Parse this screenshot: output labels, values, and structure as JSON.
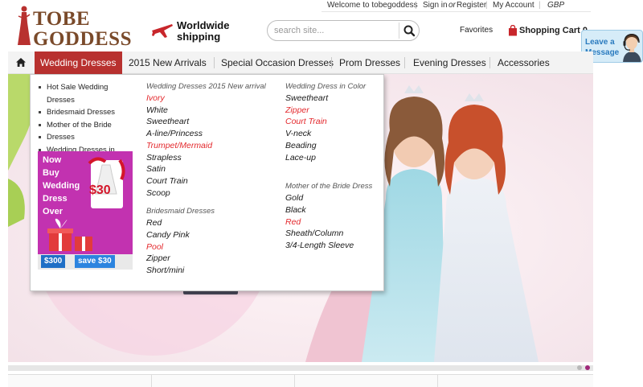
{
  "topbar": {
    "welcome": "Welcome to tobegoddess",
    "sign_in": "Sign in",
    "or": "or",
    "register": "Register",
    "account": "My Account",
    "currency": "GBP"
  },
  "logo": {
    "line1": "TOBE",
    "line2": "GODDESS"
  },
  "shipping": {
    "line1": "Worldwide",
    "line2": "shipping"
  },
  "search": {
    "placeholder": "search site...",
    "icon": "search-icon"
  },
  "header": {
    "favorites": "Favorites",
    "cart_label": "Shopping Cart",
    "cart_count": "0"
  },
  "leave_message": {
    "line1": "Leave a",
    "line2": "Message"
  },
  "nav": {
    "items": [
      {
        "label": "Wedding Dresses"
      },
      {
        "label": "2015 New Arrivals"
      },
      {
        "label": "Special Occasion Dresses"
      },
      {
        "label": "Prom Dresses"
      },
      {
        "label": "Evening Dresses"
      },
      {
        "label": "Accessories"
      }
    ]
  },
  "dropdown": {
    "links": [
      "Hot Sale Wedding Dresses",
      "Bridesmaid Dresses",
      "Mother of the Bride",
      "Dresses",
      "Wedding Dresses in Color"
    ],
    "promo": {
      "lines": [
        "Now",
        "Buy",
        "Wedding",
        "Dress",
        "Over"
      ],
      "price": "$30",
      "bottom_left": "$300",
      "bottom_right": "save $30"
    },
    "col1": {
      "heading": "Wedding Dresses 2015 New arrival",
      "items": [
        "Ivory",
        "White",
        "Sweetheart",
        "A-line/Princess",
        "Trumpet/Mermaid",
        "Strapless",
        "Satin",
        "Court Train",
        "Scoop"
      ]
    },
    "col1b": {
      "heading": "Bridesmaid Dresses",
      "items": [
        "Red",
        "Candy Pink",
        "Pool",
        "Zipper",
        "Short/mini"
      ]
    },
    "col2": {
      "heading": "Wedding Dress in Color",
      "items": [
        "Sweetheart",
        "Zipper",
        "Court Train",
        "V-neck",
        "Beading",
        "Lace-up"
      ]
    },
    "col2b": {
      "heading": "Mother of the Bride Dress",
      "items": [
        "Gold",
        "Black",
        "Red",
        "Sheath/Column",
        "3/4-Length Sleeve"
      ]
    }
  },
  "colors": {
    "accent": "#b8312f",
    "highlight_text": "#e3282c",
    "brand": "#7a4a2a",
    "promo_bg": "#c232b0"
  }
}
